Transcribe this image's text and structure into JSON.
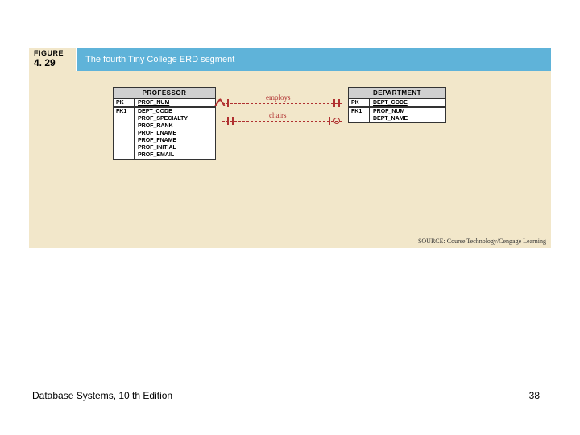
{
  "figure": {
    "label": "FIGURE",
    "number": "4. 29",
    "title": "The fourth Tiny College ERD segment"
  },
  "entities": {
    "professor": {
      "name": "PROFESSOR",
      "pk_label": "PK",
      "pk_attr": "PROF_NUM",
      "fk_label": "FK1",
      "attrs": [
        "DEPT_CODE",
        "PROF_SPECIALTY",
        "PROF_RANK",
        "PROF_LNAME",
        "PROF_FNAME",
        "PROF_INITIAL",
        "PROF_EMAIL"
      ]
    },
    "department": {
      "name": "DEPARTMENT",
      "pk_label": "PK",
      "pk_attr": "DEPT_CODE",
      "fk_label": "FK1",
      "attrs": [
        "PROF_NUM",
        "DEPT_NAME"
      ]
    }
  },
  "relationships": {
    "employs": "employs",
    "chairs": "chairs"
  },
  "source": "SOURCE: Course Technology/Cengage Learning",
  "footer": {
    "title": "Database Systems, 10 th Edition",
    "page": "38"
  }
}
